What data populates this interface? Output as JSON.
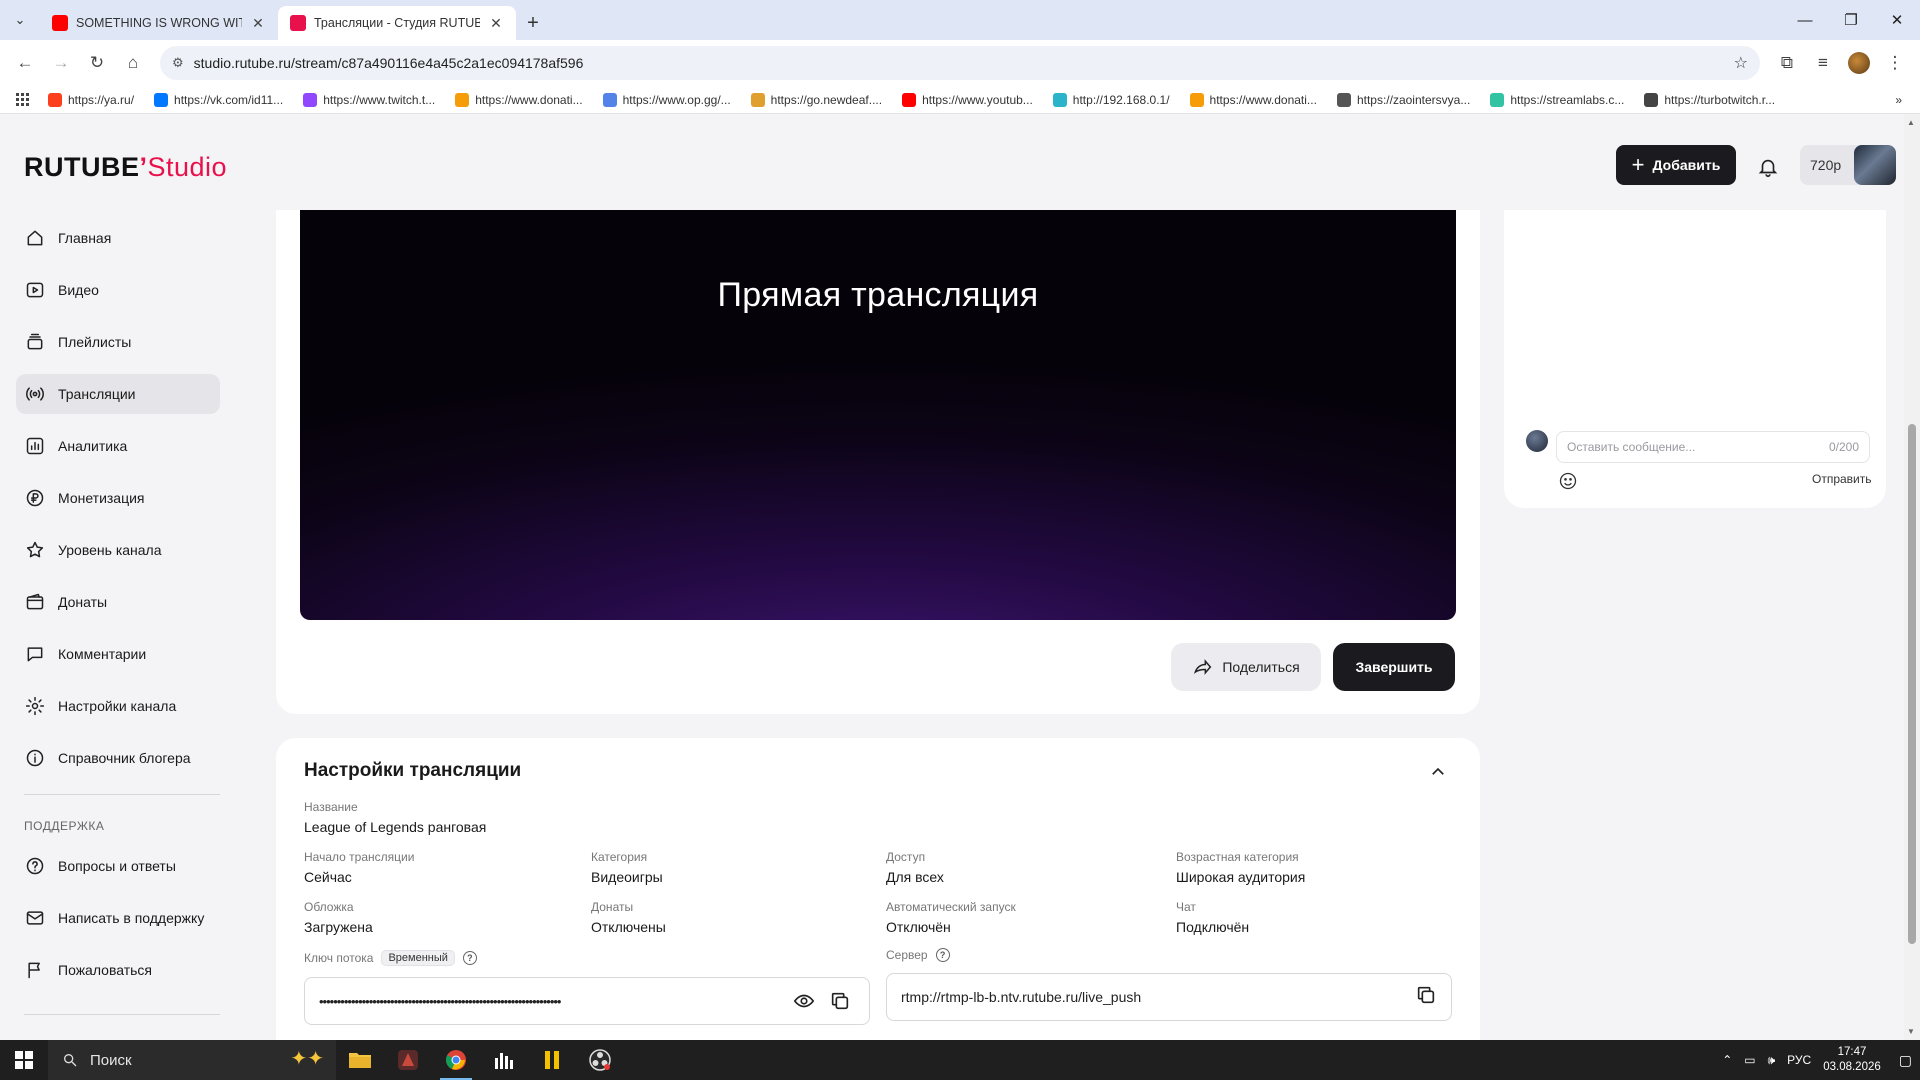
{
  "browser": {
    "tabs": [
      {
        "title": "SOMETHING IS WRONG WITH",
        "favicon": "youtube-icon",
        "active": false
      },
      {
        "title": "Трансляции - Студия RUTUBE",
        "favicon": "rutube-icon",
        "active": true
      }
    ],
    "url": "studio.rutube.ru/stream/c87a490116e4a45c2a1ec094178af596",
    "bookmarks": [
      {
        "label": "https://ya.ru/",
        "color": "#fc3f1d"
      },
      {
        "label": "https://vk.com/id11...",
        "color": "#0077ff"
      },
      {
        "label": "https://www.twitch.t...",
        "color": "#9146ff"
      },
      {
        "label": "https://www.donati...",
        "color": "#f59c07"
      },
      {
        "label": "https://www.op.gg/...",
        "color": "#5383e8"
      },
      {
        "label": "https://go.newdeaf....",
        "color": "#e0a030"
      },
      {
        "label": "https://www.youtub...",
        "color": "#ff0000"
      },
      {
        "label": "http://192.168.0.1/",
        "color": "#2bb3c9"
      },
      {
        "label": "https://www.donati...",
        "color": "#f59c07"
      },
      {
        "label": "https://zaointersvya...",
        "color": "#555555"
      },
      {
        "label": "https://streamlabs.c...",
        "color": "#31c3a2"
      },
      {
        "label": "https://turbotwitch.r...",
        "color": "#444444"
      }
    ]
  },
  "header": {
    "logo_main": "RUTUBE",
    "logo_sub": "Studio",
    "add_label": "Добавить",
    "quality": "720p"
  },
  "sidebar": {
    "items": [
      {
        "label": "Главная",
        "icon": "home-icon",
        "active": false
      },
      {
        "label": "Видео",
        "icon": "video-icon",
        "active": false
      },
      {
        "label": "Плейлисты",
        "icon": "playlist-icon",
        "active": false
      },
      {
        "label": "Трансляции",
        "icon": "broadcast-icon",
        "active": true
      },
      {
        "label": "Аналитика",
        "icon": "analytics-icon",
        "active": false
      },
      {
        "label": "Монетизация",
        "icon": "ruble-icon",
        "active": false
      },
      {
        "label": "Уровень канала",
        "icon": "star-icon",
        "active": false
      },
      {
        "label": "Донаты",
        "icon": "wallet-icon",
        "active": false
      },
      {
        "label": "Комментарии",
        "icon": "comment-icon",
        "active": false
      },
      {
        "label": "Настройки канала",
        "icon": "gear-icon",
        "active": false
      },
      {
        "label": "Справочник блогера",
        "icon": "info-icon",
        "active": false
      }
    ],
    "support_title": "ПОДДЕРЖКА",
    "support_items": [
      {
        "label": "Вопросы и ответы",
        "icon": "question-icon"
      },
      {
        "label": "Написать в поддержку",
        "icon": "mail-icon"
      },
      {
        "label": "Пожаловаться",
        "icon": "flag-icon"
      }
    ]
  },
  "player": {
    "title": "Прямая трансляция",
    "share_label": "Поделиться",
    "finish_label": "Завершить"
  },
  "chat": {
    "placeholder": "Оставить сообщение...",
    "counter": "0/200",
    "send_label": "Отправить"
  },
  "settings": {
    "title": "Настройки трансляции",
    "name_label": "Название",
    "name_value": "League of Legends ранговая",
    "fields": [
      {
        "label": "Начало трансляции",
        "value": "Сейчас"
      },
      {
        "label": "Категория",
        "value": "Видеоигры"
      },
      {
        "label": "Доступ",
        "value": "Для всех"
      },
      {
        "label": "Возрастная категория",
        "value": "Широкая аудитория"
      },
      {
        "label": "Обложка",
        "value": "Загружена"
      },
      {
        "label": "Донаты",
        "value": "Отключены"
      },
      {
        "label": "Автоматический запуск",
        "value": "Отключён"
      },
      {
        "label": "Чат",
        "value": "Подключён"
      }
    ],
    "stream_key_label": "Ключ потока",
    "stream_key_badge": "Временный",
    "stream_key_masked": "••••••••••••••••••••••••••••••••••••••••••••••••••••••••••••••••••••",
    "server_label": "Сервер",
    "server_value": "rtmp://rtmp-lb-b.ntv.rutube.ru/live_push"
  },
  "taskbar": {
    "search_placeholder": "Поиск",
    "language": "РУС",
    "time": "17:47",
    "date": "03.08.2026"
  }
}
